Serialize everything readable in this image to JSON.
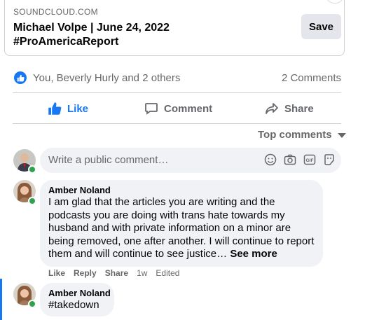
{
  "link_preview": {
    "domain": "SOUNDCLOUD.COM",
    "title_line1": "Michael Volpe | June 24, 2022",
    "title_line2": "#ProAmericaReport",
    "save_label": "Save",
    "help_glyph": "?"
  },
  "reactions": {
    "summary": "You, Beverly Hurly and 2 others",
    "comments_count": "2 Comments",
    "icon": "thumbs-up-icon",
    "accent": "#1877f2"
  },
  "actions": {
    "like_label": "Like",
    "comment_label": "Comment",
    "share_label": "Share"
  },
  "sort": {
    "label": "Top comments"
  },
  "composer": {
    "placeholder": "Write a public comment…",
    "tools": [
      "emoji-icon",
      "camera-icon",
      "gif-icon",
      "sticker-icon"
    ]
  },
  "comments": [
    {
      "author": "Amber Noland",
      "text": "I am glad that the articles you are writing and the podcasts you are doing with trans hate towards my husband and with private information on a minor are being removed, one after another. I will continue to report them and will continue to see justice…",
      "see_more": "See more",
      "like": "Like",
      "reply": "Reply",
      "share": "Share",
      "age": "1w",
      "edited": "Edited"
    },
    {
      "author": "Amber Noland",
      "text": "#takedown"
    }
  ]
}
